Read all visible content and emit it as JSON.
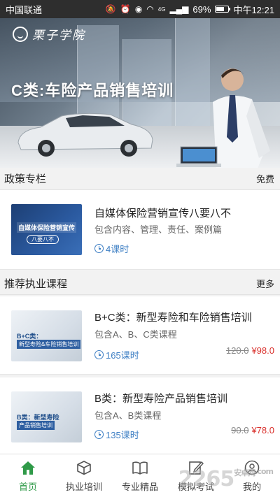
{
  "status_bar": {
    "carrier": "中国联通",
    "battery_percent": "69%",
    "battery_level": 0.69,
    "network": "4G",
    "time": "中午12:21"
  },
  "banner": {
    "logo_text": "栗子学院",
    "headline": "C类:车险产品销售培训"
  },
  "policy_section": {
    "title": "政策专栏",
    "action": "免费"
  },
  "policy_items": [
    {
      "title": "自媒体保险营销宣传八要八不",
      "subtitle": "包含内容、管理、责任、案例篇",
      "lessons": "4课时",
      "thumb_line1": "自媒体保险营销宣传",
      "thumb_line2": "八要八不"
    }
  ],
  "recommend_section": {
    "title": "推荐执业课程",
    "action": "更多"
  },
  "courses": [
    {
      "title": "B+C类：新型寿险和车险销售培训",
      "subtitle": "包含A、B、C类课程",
      "lessons": "165课时",
      "old_price": "120.0",
      "new_price": "¥98.0",
      "thumb_line1": "B+C类：",
      "thumb_line2": "新型寿险&车险销售培训"
    },
    {
      "title": "B类：新型寿险产品销售培训",
      "subtitle": "包含A、B类课程",
      "lessons": "135课时",
      "old_price": "90.0",
      "new_price": "¥78.0",
      "thumb_line1": "B类：新型寿险",
      "thumb_line2": "产品销售培训"
    }
  ],
  "bottom_nav": [
    {
      "label": "首页",
      "icon": "home-icon",
      "active": true
    },
    {
      "label": "执业培训",
      "icon": "cube-icon",
      "active": false
    },
    {
      "label": "专业精品",
      "icon": "book-icon",
      "active": false
    },
    {
      "label": "模拟考试",
      "icon": "pencil-icon",
      "active": false
    },
    {
      "label": "我的",
      "icon": "user-icon",
      "active": false
    }
  ],
  "watermark": {
    "main": "2265",
    "suffix": "安卓网",
    "text_suffix": ".com"
  },
  "colors": {
    "accent_green": "#2f9a48",
    "lesson_blue": "#3e7fc4",
    "price_red": "#d9302c"
  }
}
